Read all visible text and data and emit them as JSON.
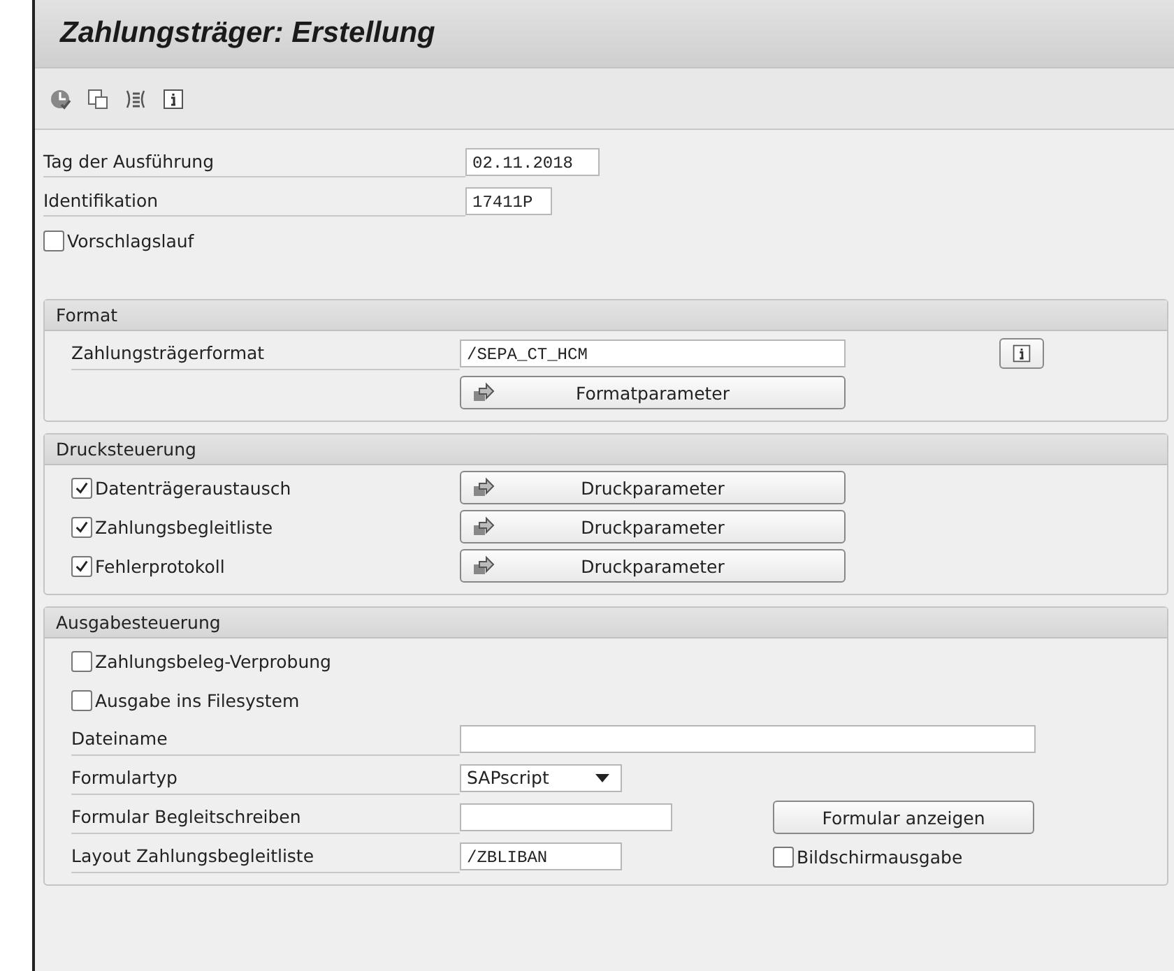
{
  "window": {
    "title": "Zahlungsträger: Erstellung"
  },
  "toolbar": [
    {
      "kind": "execute"
    },
    {
      "kind": "copy"
    },
    {
      "kind": "list"
    },
    {
      "kind": "info"
    }
  ],
  "header_fields": [
    {
      "kind": "field",
      "label": "Tag der Ausführung",
      "value": "02.11.2018"
    },
    {
      "kind": "field",
      "label": "Identifikation",
      "value": "17411P"
    },
    {
      "kind": "checkbox",
      "label": "Vorschlagslauf",
      "checked": false
    }
  ],
  "format": {
    "title": "Format",
    "label": "Zahlungsträgerformat",
    "value": "/SEPA_CT_HCM",
    "button": "Formatparameter"
  },
  "print_control": {
    "title": "Drucksteuerung",
    "rows": [
      {
        "label": "Datenträgeraustausch",
        "checked": true,
        "button": "Druckparameter"
      },
      {
        "label": "Zahlungsbegleitliste",
        "checked": true,
        "button": "Druckparameter"
      },
      {
        "label": "Fehlerprotokoll",
        "checked": true,
        "button": "Druckparameter"
      }
    ]
  },
  "output_control": {
    "title": "Ausgabesteuerung",
    "rows": [
      {
        "kind": "checkbox",
        "label": "Zahlungsbeleg-Verprobung",
        "checked": false
      },
      {
        "kind": "checkbox",
        "label": "Ausgabe ins Filesystem",
        "checked": false
      },
      {
        "kind": "field",
        "label": "Dateiname"
      },
      {
        "kind": "dropdown",
        "label": "Formulartyp",
        "value": "SAPscript"
      },
      {
        "kind": "field",
        "label": "Formular Begleitschreiben",
        "button": "Formular anzeigen"
      },
      {
        "kind": "field",
        "label": "Layout Zahlungsbegleitliste",
        "value": "/ZBLIBAN",
        "checkbox": {
          "label": "Bildschirmausgabe",
          "checked": false
        }
      }
    ]
  }
}
